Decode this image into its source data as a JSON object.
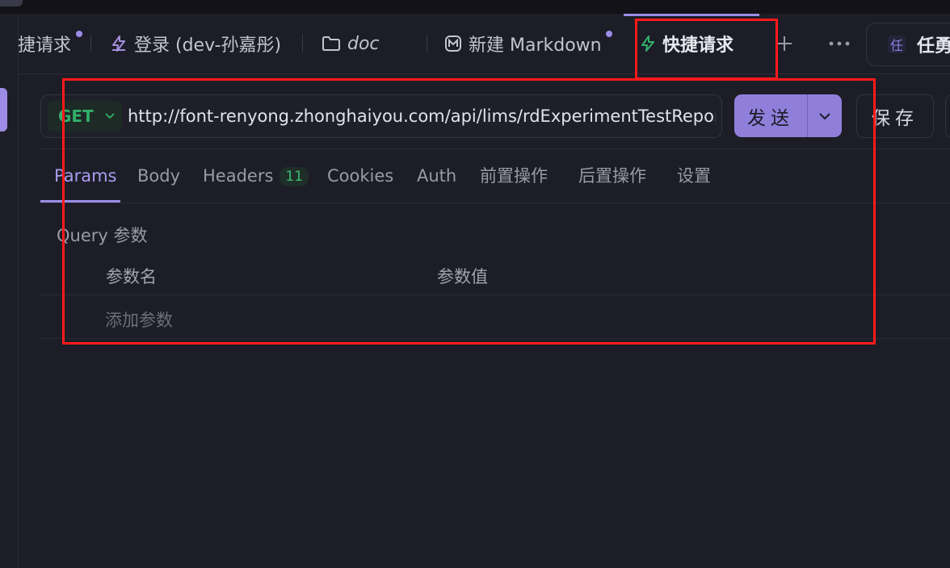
{
  "tabs": [
    {
      "label": "捷请求",
      "icon": "lightning-icon",
      "unsaved": true
    },
    {
      "label": "登录 (dev-孙嘉彤)",
      "icon": "lightning-icon",
      "unsaved": false
    },
    {
      "label": "doc",
      "icon": "folder-icon",
      "unsaved": false
    },
    {
      "label": "新建 Markdown",
      "icon": "markdown-icon",
      "unsaved": true
    },
    {
      "label": "快捷请求",
      "icon": "lightning-icon",
      "active": true
    }
  ],
  "environment": {
    "badge": "任",
    "name": "任勇"
  },
  "request": {
    "method": "GET",
    "url": "http://font-renyong.zhonghaiyou.com/api/lims/rdExperimentTestReport",
    "send_label": "发送",
    "save_label": "保存"
  },
  "subtabs": [
    {
      "label": "Params",
      "active": true
    },
    {
      "label": "Body"
    },
    {
      "label": "Headers",
      "count": "11"
    },
    {
      "label": "Cookies"
    },
    {
      "label": "Auth"
    },
    {
      "label": "前置操作"
    },
    {
      "label": "后置操作"
    },
    {
      "label": "设置"
    }
  ],
  "params": {
    "section_label": "Query 参数",
    "col_name": "参数名",
    "col_value": "参数值",
    "add_placeholder": "添加参数"
  },
  "colors": {
    "accent": "#9c8ce6",
    "get_method": "#33b06b",
    "highlight": "#ff1a1a"
  }
}
